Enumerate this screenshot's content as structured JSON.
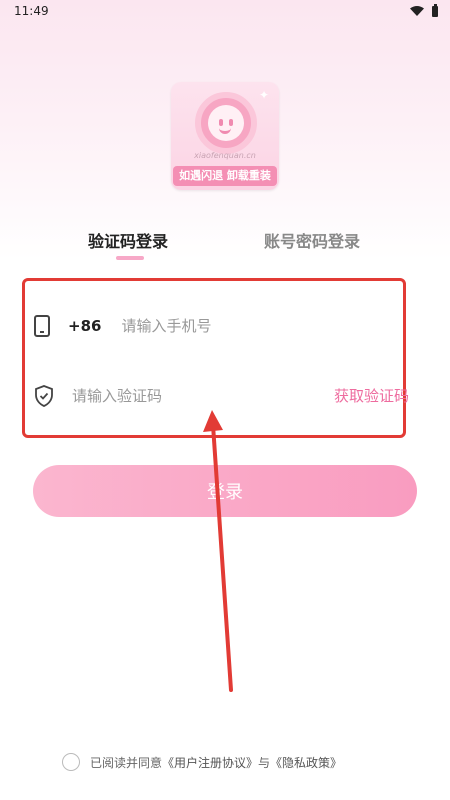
{
  "status_bar": {
    "time": "11:49"
  },
  "logo": {
    "url_text": "xiaofenquan.cn",
    "banner_text": "如遇闪退 卸载重装"
  },
  "tabs": [
    {
      "label": "验证码登录",
      "active": true
    },
    {
      "label": "账号密码登录",
      "active": false
    }
  ],
  "form": {
    "country_code": "+86",
    "phone_placeholder": "请输入手机号",
    "code_placeholder": "请输入验证码",
    "get_code_label": "获取验证码"
  },
  "login_button_label": "登录",
  "agreement": {
    "prefix": "已阅读并同意",
    "user_agreement": "《用户注册协议》",
    "conjunction": "与",
    "privacy_policy": "《隐私政策》"
  },
  "colors": {
    "accent_pink": "#ee6c9f",
    "button_pink": "#f99cc0",
    "annotation_red": "#e23b35"
  }
}
